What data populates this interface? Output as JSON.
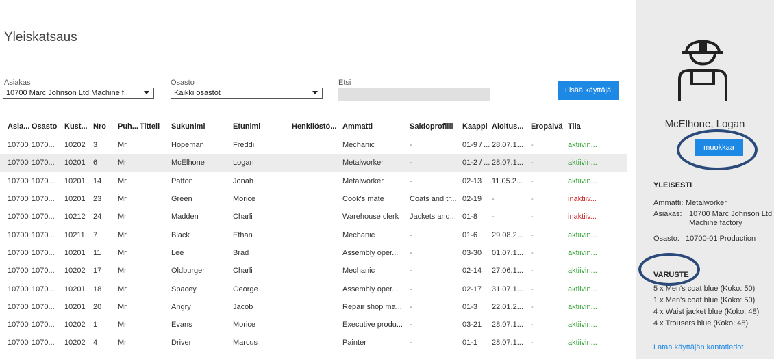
{
  "title": "Yleiskatsaus",
  "filters": {
    "customer_label": "Asiakas",
    "customer_value": "10700 Marc Johnson Ltd Machine f...",
    "department_label": "Osasto",
    "department_value": "Kaikki osastot",
    "search_label": "Etsi",
    "search_value": "",
    "add_user_label": "Lisää käyttäjä"
  },
  "table": {
    "headers": [
      "Asia...",
      "Osasto",
      "Kust...",
      "Nro",
      "Puh...",
      "Titteli",
      "Sukunimi",
      "Etunimi",
      "Henkilöstö...",
      "Ammatti",
      "Saldoprofiili",
      "Kaappi",
      "Aloitus...",
      "Eropäivä",
      "Tila"
    ],
    "rows": [
      [
        "10700",
        "1070...",
        "10202",
        "3",
        "Mr",
        "",
        "Hopeman",
        "Freddi",
        "",
        "Mechanic",
        "-",
        "01-9 / ...",
        "28.07.1...",
        "-",
        "aktiivin..."
      ],
      [
        "10700",
        "1070...",
        "10201",
        "6",
        "Mr",
        "",
        "McElhone",
        "Logan",
        "",
        "Metalworker",
        "-",
        "01-2 / ...",
        "28.07.1...",
        "-",
        "aktiivin..."
      ],
      [
        "10700",
        "1070...",
        "10201",
        "14",
        "Mr",
        "",
        "Patton",
        "Jonah",
        "",
        "Metalworker",
        "-",
        "02-13",
        "11.05.2...",
        "-",
        "aktiivin..."
      ],
      [
        "10700",
        "1070...",
        "10201",
        "23",
        "Mr",
        "",
        "Green",
        "Morice",
        "",
        "Cook's mate",
        "Coats and tr...",
        "02-19",
        "-",
        "-",
        "inaktiiv..."
      ],
      [
        "10700",
        "1070...",
        "10212",
        "24",
        "Mr",
        "",
        "Madden",
        "Charli",
        "",
        "Warehouse clerk",
        "Jackets and...",
        "01-8",
        "-",
        "-",
        "inaktiiv..."
      ],
      [
        "10700",
        "1070...",
        "10211",
        "7",
        "Mr",
        "",
        "Black",
        "Ethan",
        "",
        "Mechanic",
        "-",
        "01-6",
        "29.08.2...",
        "-",
        "aktiivin..."
      ],
      [
        "10700",
        "1070...",
        "10201",
        "11",
        "Mr",
        "",
        "Lee",
        "Brad",
        "",
        "Assembly oper...",
        "-",
        "03-30",
        "01.07.1...",
        "-",
        "aktiivin..."
      ],
      [
        "10700",
        "1070...",
        "10202",
        "17",
        "Mr",
        "",
        "Oldburger",
        "Charli",
        "",
        "Mechanic",
        "-",
        "02-14",
        "27.06.1...",
        "-",
        "aktiivin..."
      ],
      [
        "10700",
        "1070...",
        "10201",
        "18",
        "Mr",
        "",
        "Spacey",
        "George",
        "",
        "Assembly oper...",
        "-",
        "02-17",
        "31.07.1...",
        "-",
        "aktiivin..."
      ],
      [
        "10700",
        "1070...",
        "10201",
        "20",
        "Mr",
        "",
        "Angry",
        "Jacob",
        "",
        "Repair shop ma...",
        "-",
        "01-3",
        "22.01.2...",
        "-",
        "aktiivin..."
      ],
      [
        "10700",
        "1070...",
        "10202",
        "1",
        "Mr",
        "",
        "Evans",
        "Morice",
        "",
        "Executive produ...",
        "-",
        "03-21",
        "28.07.1...",
        "-",
        "aktiivin..."
      ],
      [
        "10700",
        "1070...",
        "10202",
        "4",
        "Mr",
        "",
        "Driver",
        "Marcus",
        "",
        "Painter",
        "-",
        "01-1",
        "28.07.1...",
        "-",
        "aktiivin..."
      ]
    ],
    "selected_row": 1,
    "status_colors": {
      "active": "#2e9e2e",
      "inactive": "#d32f2f"
    }
  },
  "detail": {
    "avatar_icon": "worker-avatar-icon",
    "name": "McElhone, Logan",
    "edit_label": "muokkaa",
    "general_title": "YLEISESTI",
    "occupation_key": "Ammatti:",
    "occupation_value": "Metalworker",
    "customer_key": "Asiakas:",
    "customer_value_1": "10700 Marc Johnson Ltd",
    "customer_value_2": "Machine factory",
    "department_key": "Osasto:",
    "department_value": "10700-01 Production",
    "equipment_title": "VARUSTE",
    "equipment": [
      "5 x  Men's coat blue (Koko: 50)",
      "1 x  Men's coat blue (Koko: 50)",
      "4 x  Waist jacket blue (Koko: 48)",
      "4 x  Trousers blue (Koko: 48)"
    ],
    "download_label": "Lataa käyttäjän kantatiedot"
  },
  "colors": {
    "accent": "#1e88e5",
    "annotation_ring": "#2b4a7a",
    "sidebar_bg": "#ebebeb"
  }
}
